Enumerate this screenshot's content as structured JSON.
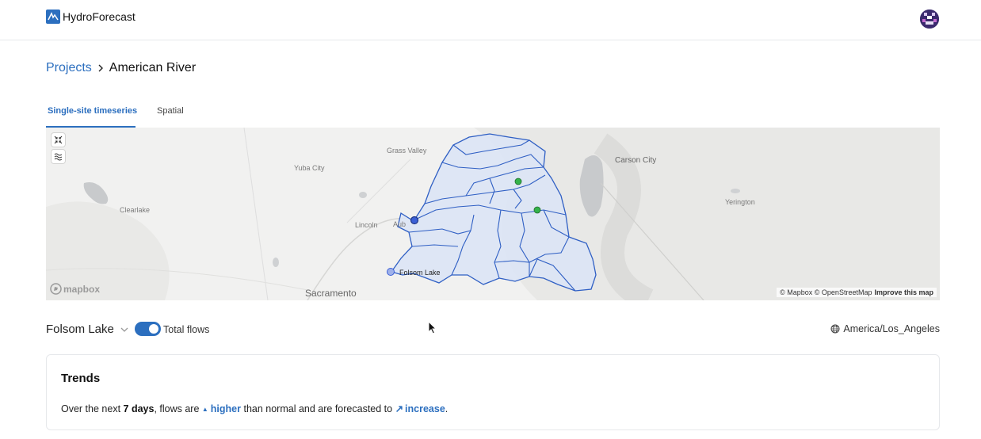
{
  "app": {
    "name": "HydroForecast"
  },
  "breadcrumb": {
    "root": "Projects",
    "current": "American River"
  },
  "tabs": [
    {
      "label": "Single-site timeseries",
      "active": true
    },
    {
      "label": "Spatial",
      "active": false
    }
  ],
  "map": {
    "place_labels": {
      "grass_valley": "Grass Valley",
      "yuba_city": "Yuba City",
      "clearlake": "Clearlake",
      "lincoln": "Lincoln",
      "auburn": "Aub",
      "sacramento": "Sacramento",
      "folsom_lake": "Folsom Lake",
      "carson_city": "Carson City",
      "yerington": "Yerington"
    },
    "logo_text": "mapbox",
    "attribution": {
      "text": "© Mapbox © OpenStreetMap",
      "improve": "Improve this map"
    },
    "colors": {
      "basin_stroke": "#2f5fc4",
      "basin_fill": "#dde6f7",
      "marker_green": "#34b24a",
      "marker_blue": "#3b5fd6"
    }
  },
  "controls": {
    "site": "Folsom Lake",
    "toggle_label": "Total flows",
    "toggle_on": true,
    "timezone": "America/Los_Angeles"
  },
  "trends": {
    "title": "Trends",
    "sentence": {
      "part1": "Over the next ",
      "days": "7 days",
      "part2": ", flows are ",
      "level_arrow": "▲",
      "level": "higher",
      "part3": " than normal and are forecasted to ",
      "direction_arrow": "↗",
      "direction": "increase",
      "part4": "."
    }
  }
}
